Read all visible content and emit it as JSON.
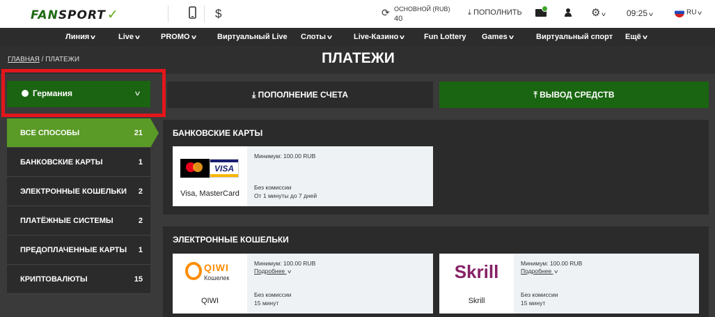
{
  "topbar": {
    "logo": {
      "part1": "FAN",
      "part2": "SPORT"
    },
    "currency_icon": "$",
    "balance": {
      "label": "ОСНОВНОЙ (RUB)",
      "amount": "40"
    },
    "deposit_label": "ПОПОЛНИТЬ",
    "time": "09:25",
    "lang": "RU"
  },
  "nav": {
    "items": [
      {
        "label": "Линия",
        "dd": true
      },
      {
        "label": "Live",
        "dd": true
      },
      {
        "label": "PROMO",
        "dd": true
      },
      {
        "label": "Виртуальный Live",
        "dd": false
      },
      {
        "label": "Слоты",
        "dd": true
      },
      {
        "label": "Live-Казино",
        "dd": true
      },
      {
        "label": "Fun Lottery",
        "dd": false
      },
      {
        "label": "Games",
        "dd": true
      },
      {
        "label": "Виртуальный спорт",
        "dd": false
      },
      {
        "label": "Ещё",
        "dd": true
      }
    ]
  },
  "breadcrumb": {
    "home": "ГЛАВНАЯ",
    "sep": "/",
    "current": "ПЛАТЕЖИ"
  },
  "page_title": "ПЛАТЕЖИ",
  "country": {
    "label": "Германия"
  },
  "tabs": {
    "deposit": "ПОПОЛНЕНИЕ СЧЕТА",
    "withdraw": "ВЫВОД СРЕДСТВ"
  },
  "sidebar": {
    "items": [
      {
        "label": "ВСЕ СПОСОБЫ",
        "count": "21",
        "active": true
      },
      {
        "label": "БАНКОВСКИЕ КАРТЫ",
        "count": "1"
      },
      {
        "label": "ЭЛЕКТРОННЫЕ КОШЕЛЬКИ",
        "count": "2"
      },
      {
        "label": "ПЛАТЁЖНЫЕ СИСТЕМЫ",
        "count": "2"
      },
      {
        "label": "ПРЕДОПЛАЧЕННЫЕ КАРТЫ",
        "count": "1"
      },
      {
        "label": "КРИПТОВАЛЮТЫ",
        "count": "15"
      }
    ]
  },
  "sections": {
    "cards": {
      "title": "БАНКОВСКИЕ КАРТЫ",
      "methods": [
        {
          "name": "Visa, MasterCard",
          "min": "Минимум: 100.00 RUB",
          "fee": "Без комиссии",
          "time": "От 1 минуты до 7 дней",
          "logo_text": "VISA"
        }
      ]
    },
    "wallets": {
      "title": "ЭЛЕКТРОННЫЕ КОШЕЛЬКИ",
      "methods": [
        {
          "name": "QIWI",
          "min": "Минимум: 100.00 RUB",
          "more": "Подробнее",
          "fee": "Без комиссии",
          "time": "15 минут",
          "logo_text": "QIWI",
          "logo_sub": "Кошелек"
        },
        {
          "name": "Skrill",
          "min": "Минимум: 100.00 RUB",
          "more": "Подробнее",
          "fee": "Без комиссии",
          "time": "15 минут",
          "logo_text": "Skrill"
        }
      ]
    }
  },
  "colors": {
    "brand_green": "#1b6412",
    "active_green": "#5a9a26",
    "highlight_red": "#e3161b"
  }
}
